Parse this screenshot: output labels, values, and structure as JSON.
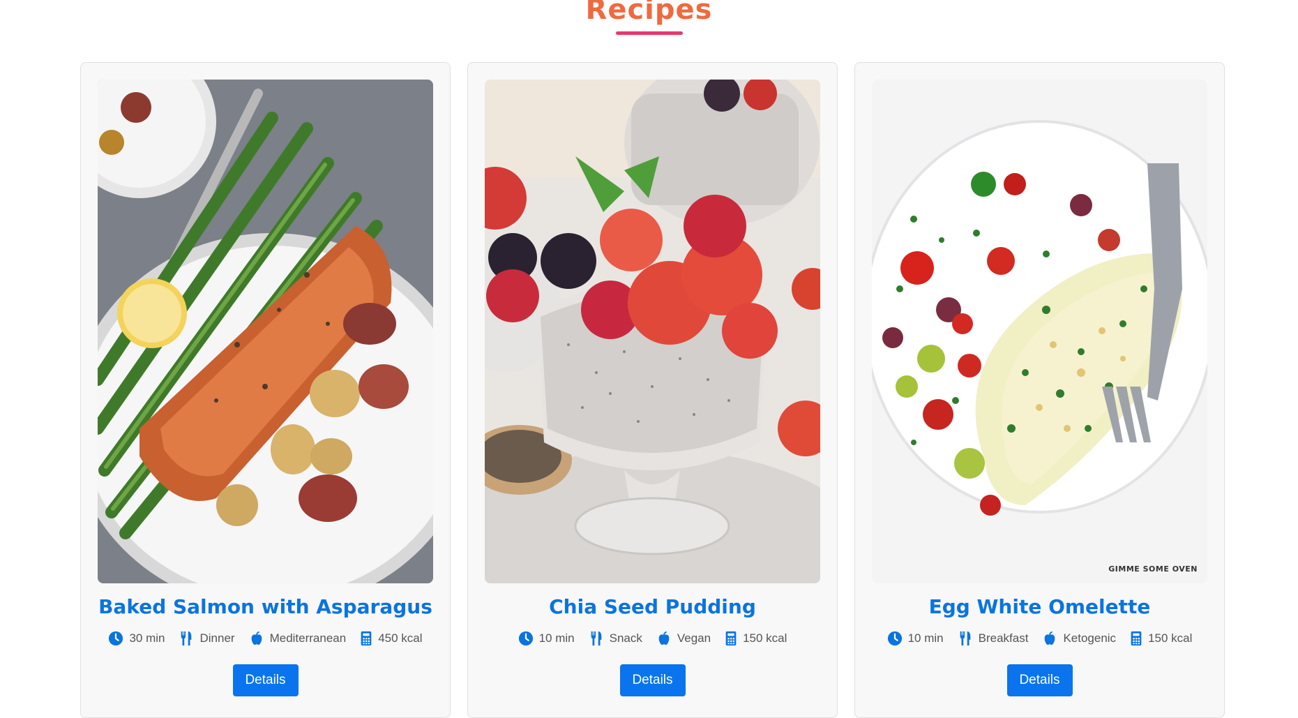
{
  "page": {
    "title": "Recipes"
  },
  "colors": {
    "accent_title": "#ef6a3f",
    "underline": "#e8386d",
    "link_blue": "#0a74e0",
    "button": "#0a74ee"
  },
  "recipes": [
    {
      "title": "Baked Salmon with Asparagus",
      "time": "30 min",
      "meal": "Dinner",
      "cuisine": "Mediterranean",
      "calories": "450 kcal",
      "button_label": "Details",
      "image": "baked-salmon-photo"
    },
    {
      "title": "Chia Seed Pudding",
      "time": "10 min",
      "meal": "Snack",
      "cuisine": "Vegan",
      "calories": "150 kcal",
      "button_label": "Details",
      "image": "chia-pudding-photo"
    },
    {
      "title": "Egg White Omelette",
      "time": "10 min",
      "meal": "Breakfast",
      "cuisine": "Ketogenic",
      "calories": "150 kcal",
      "button_label": "Details",
      "image": "egg-omelette-photo",
      "watermark": "GIMME SOME OVEN"
    }
  ],
  "icons": [
    "clock-icon",
    "utensils-icon",
    "apple-icon",
    "calculator-icon"
  ]
}
